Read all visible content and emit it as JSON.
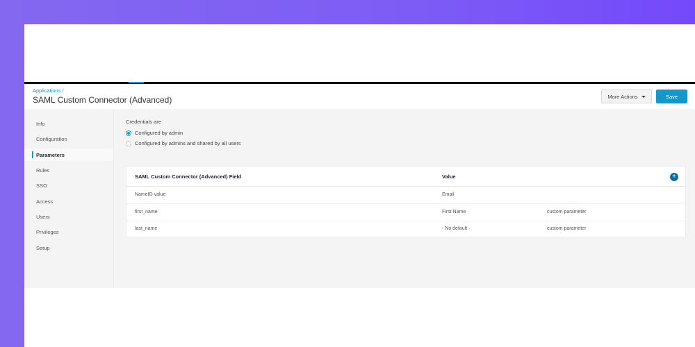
{
  "header": {
    "breadcrumb": "Applications /",
    "title": "SAML Custom Connector (Advanced)",
    "more_actions_label": "More Actions",
    "save_label": "Save"
  },
  "sidebar": {
    "items": [
      {
        "label": "Info",
        "active": false
      },
      {
        "label": "Configuration",
        "active": false
      },
      {
        "label": "Parameters",
        "active": true
      },
      {
        "label": "Rules",
        "active": false
      },
      {
        "label": "SSO",
        "active": false
      },
      {
        "label": "Access",
        "active": false
      },
      {
        "label": "Users",
        "active": false
      },
      {
        "label": "Privileges",
        "active": false
      },
      {
        "label": "Setup",
        "active": false
      }
    ]
  },
  "credentials": {
    "label": "Credentials are",
    "options": [
      {
        "label": "Configured by admin",
        "checked": true
      },
      {
        "label": "Configured by admins and shared by all users",
        "checked": false
      }
    ]
  },
  "table": {
    "columns": [
      "SAML Custom Connector (Advanced) Field",
      "Value"
    ],
    "rows": [
      {
        "field": "NameID value",
        "value": "Email",
        "note": ""
      },
      {
        "field": "first_name",
        "value": "First Name",
        "note": "custom parameter"
      },
      {
        "field": "last_name",
        "value": "- No default -",
        "note": "custom parameter"
      }
    ]
  },
  "colors": {
    "accent": "#1597c9",
    "add_button": "#0f6e96",
    "background_gradient_start": "#8468f0",
    "background_gradient_end": "#7449fb"
  },
  "icons": {
    "more_actions": "caret-down-icon",
    "add": "plus-icon"
  }
}
